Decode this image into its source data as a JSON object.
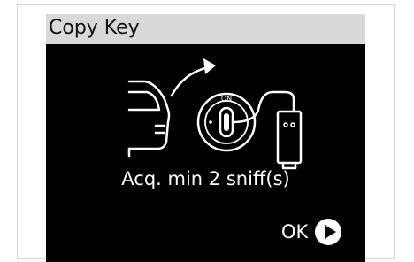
{
  "header": {
    "title": "Copy Key"
  },
  "illustration": {
    "icon": "car-key-sniffer-icon",
    "ignition_label": "ON"
  },
  "message": {
    "text": "Acq. min 2 sniff(s)"
  },
  "ok_button": {
    "label": "OK",
    "icon": "play-circle-icon"
  },
  "colors": {
    "screen_background": "#000000",
    "title_bar_background": "#d9d9d9",
    "foreground": "#ffffff",
    "title_text": "#111111"
  }
}
